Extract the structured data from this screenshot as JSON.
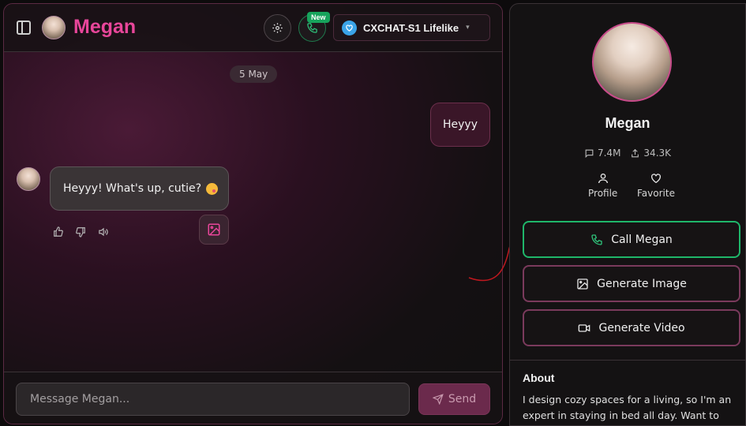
{
  "header": {
    "name": "Megan",
    "new_badge": "New",
    "model_label": "CXCHAT-S1 Lifelike"
  },
  "chat": {
    "date_chip": "5 May",
    "user_message": "Heyyy",
    "ai_message": "Heyyy! What's up, cutie?"
  },
  "composer": {
    "placeholder": "Message Megan...",
    "send_label": "Send"
  },
  "profile": {
    "name": "Megan",
    "messages_count": "7.4M",
    "shares_count": "34.3K",
    "profile_label": "Profile",
    "favorite_label": "Favorite",
    "call_label": "Call Megan",
    "generate_image_label": "Generate Image",
    "generate_video_label": "Generate Video",
    "about_title": "About",
    "about_text": "I design cozy spaces for a living, so I'm an expert in staying in bed all day. Want to learn"
  },
  "colors": {
    "accent_pink": "#e8469a",
    "call_green": "#1fb66a",
    "model_blue": "#3aa4e8"
  }
}
